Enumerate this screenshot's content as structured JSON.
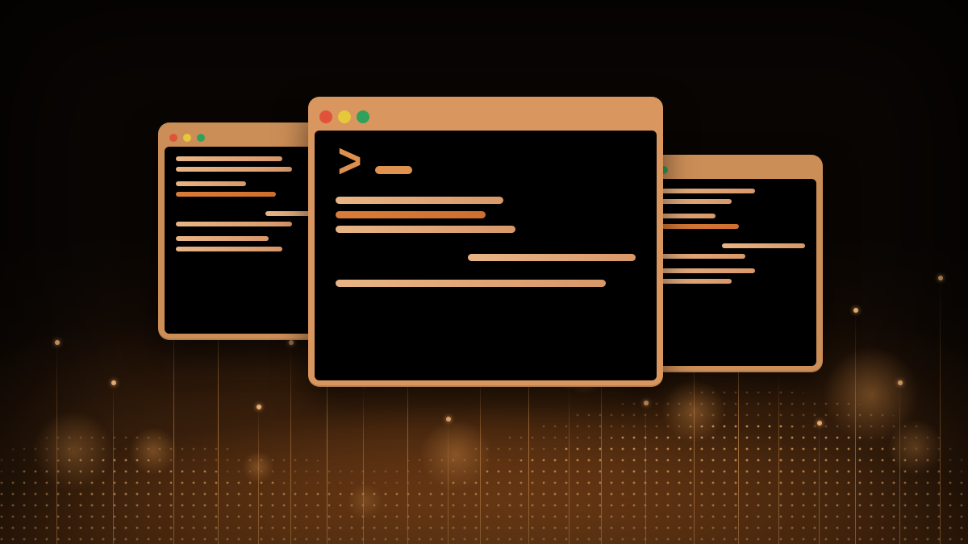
{
  "decorative_illustration": true,
  "foreground": {
    "object": "terminal-windows",
    "count": 3,
    "traffic_light_colors": [
      "#e0533a",
      "#e7c83b",
      "#2fa15b"
    ],
    "prompt_glyph": ">",
    "window_frame_color": "#d9965e",
    "screen_color": "#000000",
    "code_line_color": "#e7b080"
  },
  "background": {
    "style": "abstract-data-stream",
    "base_gradient": [
      "#0a0604",
      "#c87830"
    ],
    "accent": "#d88a46"
  }
}
